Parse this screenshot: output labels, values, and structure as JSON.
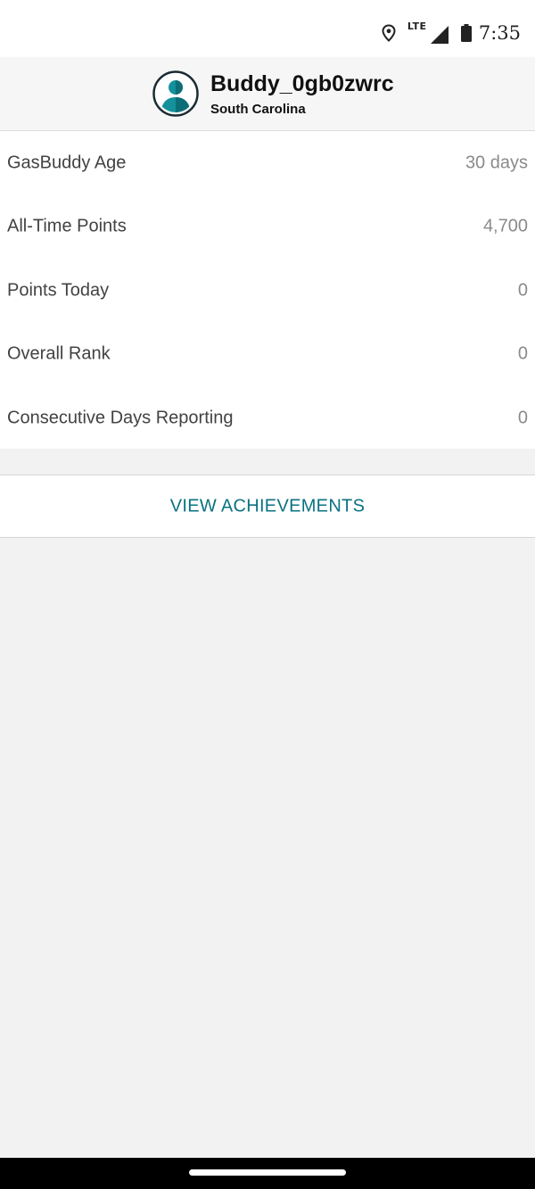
{
  "status_bar": {
    "network": "LTE",
    "time": "7:35",
    "icons": [
      "location-icon",
      "signal-icon",
      "battery-icon"
    ]
  },
  "profile": {
    "username": "Buddy_0gb0zwrc",
    "location": "South Carolina",
    "avatar_icon": "person-avatar-icon"
  },
  "stats": [
    {
      "label": "GasBuddy Age",
      "value": "30 days"
    },
    {
      "label": "All-Time Points",
      "value": "4,700"
    },
    {
      "label": "Points Today",
      "value": "0"
    },
    {
      "label": "Overall Rank",
      "value": "0"
    },
    {
      "label": "Consecutive Days Reporting",
      "value": "0"
    }
  ],
  "actions": {
    "view_achievements": "VIEW ACHIEVEMENTS"
  },
  "colors": {
    "accent": "#0a7280",
    "avatar_teal": "#14919b",
    "page_background": "#f2f2f2"
  }
}
